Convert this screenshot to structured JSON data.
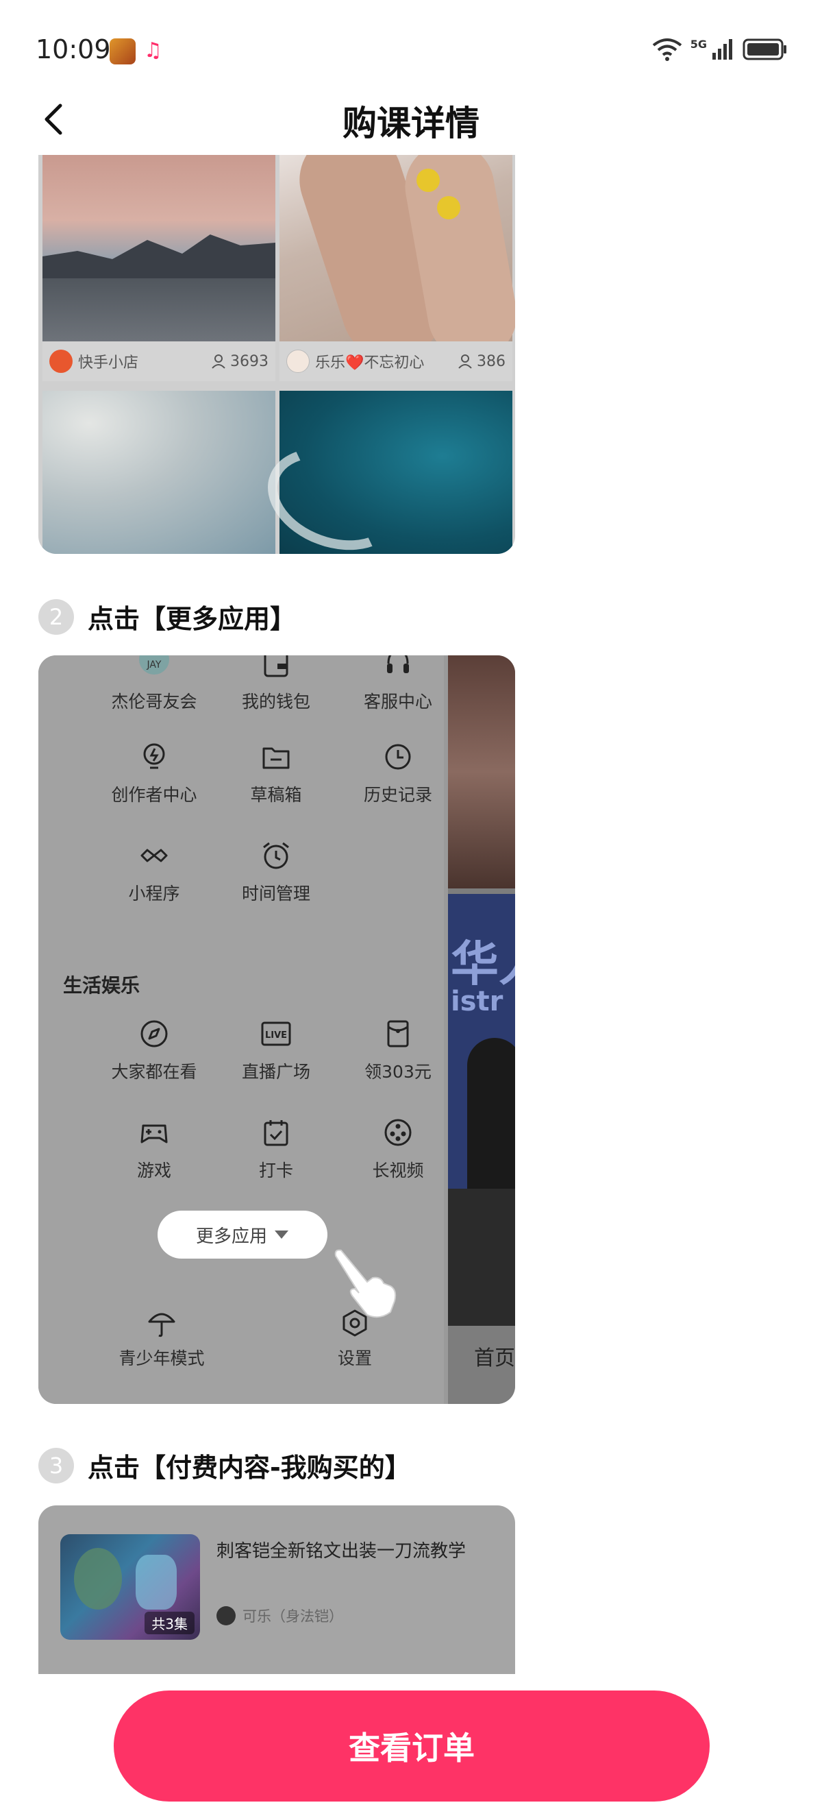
{
  "status_bar": {
    "time": "10:09",
    "network": "5G"
  },
  "header": {
    "title": "购课详情"
  },
  "step1_card": {
    "items": [
      {
        "author": "快手小店",
        "views": "3693"
      },
      {
        "author": "乐乐❤️不忘初心",
        "views": "386"
      }
    ]
  },
  "step2": {
    "number": "2",
    "title": "点击【更多应用】",
    "tools_row1": [
      "杰伦哥友会",
      "我的钱包",
      "客服中心"
    ],
    "tools_row2": [
      "创作者中心",
      "草稿箱",
      "历史记录"
    ],
    "tools_row3": [
      "小程序",
      "时间管理"
    ],
    "section_label": "生活娱乐",
    "life_row1": [
      "大家都在看",
      "直播广场",
      "领303元"
    ],
    "life_row2": [
      "游戏",
      "打卡",
      "长视频"
    ],
    "more_button": "更多应用",
    "bottom": [
      "青少年模式",
      "设置"
    ],
    "side_home": "首页",
    "side_text": "华人",
    "side_text2": "istr"
  },
  "step3": {
    "number": "3",
    "title": "点击【付费内容-我购买的】",
    "video_title": "刺客铠全新铭文出装一刀流教学",
    "episodes": "共3集",
    "author": "可乐（身法铠）"
  },
  "cta": {
    "label": "查看订单"
  },
  "colors": {
    "accent": "#fe3366",
    "overlay": "#9a9a9a"
  }
}
